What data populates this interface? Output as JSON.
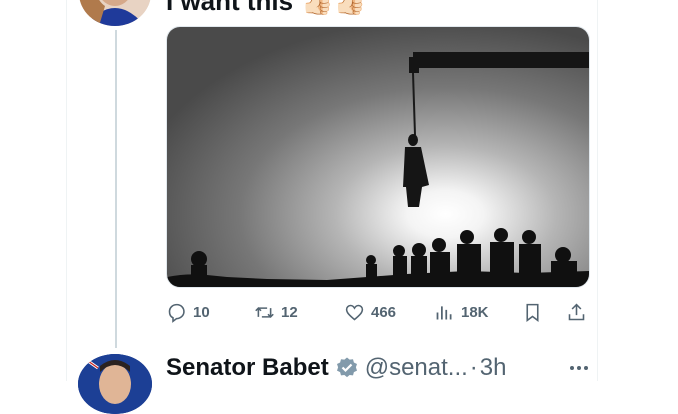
{
  "tweet": {
    "text": "I want this",
    "text_emoji": "👍🏻👍🏻",
    "media_alt": "Silhouette of a hanging from a crane with onlookers",
    "actions": {
      "replies": "10",
      "retweets": "12",
      "likes": "466",
      "views": "18K"
    }
  },
  "next_tweet": {
    "name": "Senator Babet",
    "handle": "@senat...",
    "separator": "·",
    "time": "3h"
  },
  "colors": {
    "text_primary": "#0f1419",
    "text_secondary": "#536471",
    "verified": "#829aab",
    "thread_line": "#cfd9de"
  },
  "icons": [
    "reply-icon",
    "retweet-icon",
    "like-icon",
    "views-icon",
    "bookmark-icon",
    "share-icon",
    "verified-badge-icon",
    "more-icon"
  ]
}
